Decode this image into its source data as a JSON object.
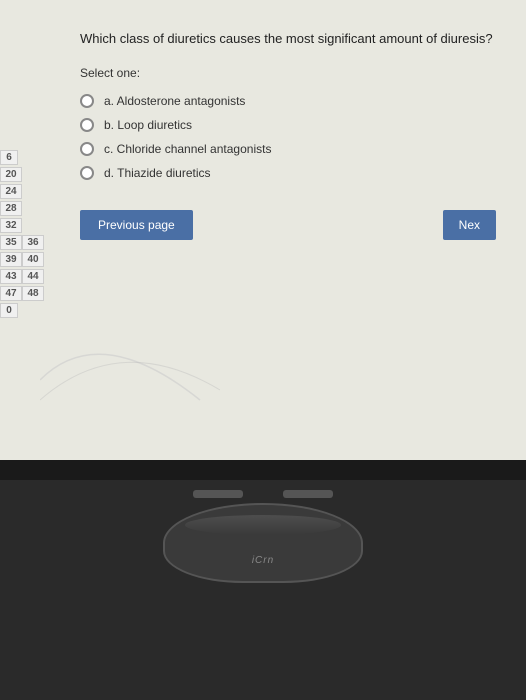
{
  "quiz": {
    "question": "Which class of diuretics causes the most significant amount of diuresis?",
    "select_label": "Select one:",
    "options": [
      {
        "id": "a",
        "label": "a. Aldosterone antagonists"
      },
      {
        "id": "b",
        "label": "b. Loop diuretics"
      },
      {
        "id": "c",
        "label": "c. Chloride channel antagonists"
      },
      {
        "id": "d",
        "label": "d. Thiazide diuretics"
      }
    ],
    "prev_button": "Previous page",
    "next_button": "Nex"
  },
  "sidebar": {
    "numbers": [
      {
        "val": "6"
      },
      {
        "val": "20"
      },
      {
        "val": "24"
      },
      {
        "val": "28"
      },
      {
        "val": "32"
      },
      {
        "val": "36"
      },
      {
        "val": "40"
      },
      {
        "val": "44"
      },
      {
        "val": "48"
      },
      {
        "val": "0"
      }
    ],
    "numbers2": [
      {
        "val": "35"
      },
      {
        "val": "39"
      },
      {
        "val": "43"
      },
      {
        "val": "47"
      }
    ]
  },
  "monitor": {
    "brand": "iCrn"
  }
}
